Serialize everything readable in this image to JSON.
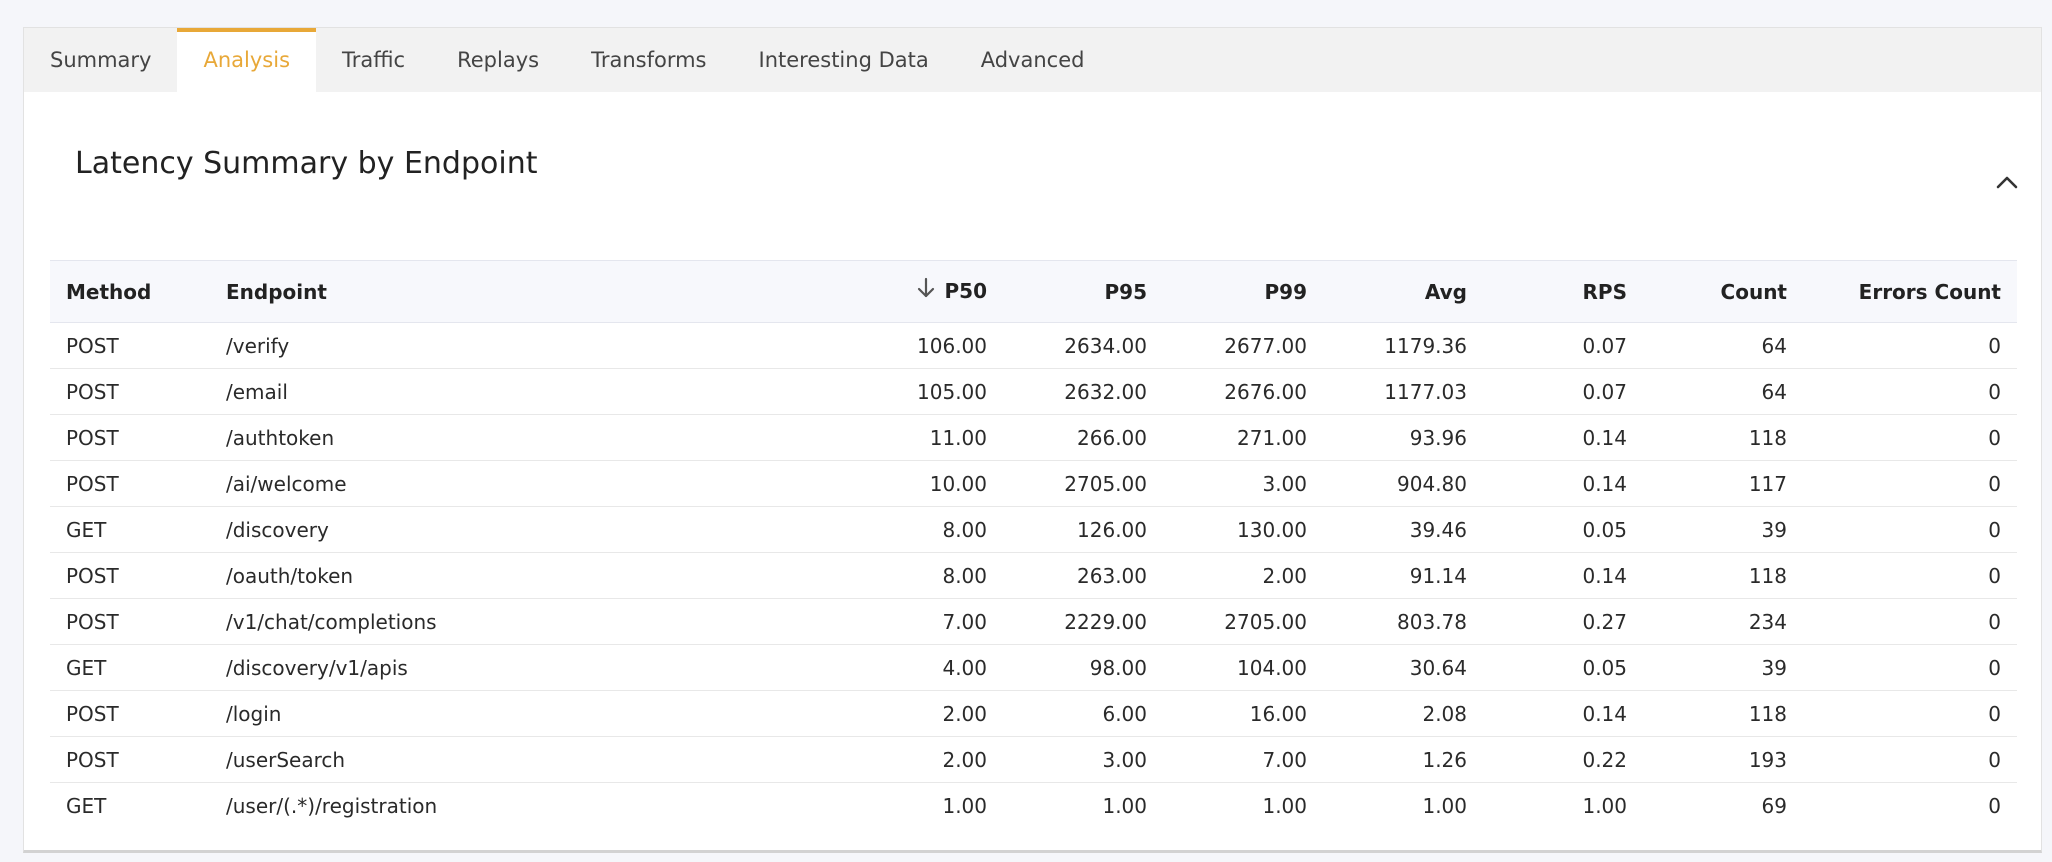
{
  "tabs": [
    {
      "label": "Summary",
      "active": false
    },
    {
      "label": "Analysis",
      "active": true
    },
    {
      "label": "Traffic",
      "active": false
    },
    {
      "label": "Replays",
      "active": false
    },
    {
      "label": "Transforms",
      "active": false
    },
    {
      "label": "Interesting Data",
      "active": false
    },
    {
      "label": "Advanced",
      "active": false
    }
  ],
  "panel": {
    "title": "Latency Summary by Endpoint",
    "collapse_icon": "chevron-up-icon"
  },
  "table": {
    "sort_icon": "arrow-down-icon",
    "sorted_column": "P50",
    "columns": [
      "Method",
      "Endpoint",
      "P50",
      "P95",
      "P99",
      "Avg",
      "RPS",
      "Count",
      "Errors Count"
    ],
    "rows": [
      {
        "method": "POST",
        "endpoint": "/verify",
        "p50": "106.00",
        "p95": "2634.00",
        "p99": "2677.00",
        "avg": "1179.36",
        "rps": "0.07",
        "count": "64",
        "errors": "0"
      },
      {
        "method": "POST",
        "endpoint": "/email",
        "p50": "105.00",
        "p95": "2632.00",
        "p99": "2676.00",
        "avg": "1177.03",
        "rps": "0.07",
        "count": "64",
        "errors": "0"
      },
      {
        "method": "POST",
        "endpoint": "/authtoken",
        "p50": "11.00",
        "p95": "266.00",
        "p99": "271.00",
        "avg": "93.96",
        "rps": "0.14",
        "count": "118",
        "errors": "0"
      },
      {
        "method": "POST",
        "endpoint": "/ai/welcome",
        "p50": "10.00",
        "p95": "2705.00",
        "p99": "3.00",
        "avg": "904.80",
        "rps": "0.14",
        "count": "117",
        "errors": "0"
      },
      {
        "method": "GET",
        "endpoint": "/discovery",
        "p50": "8.00",
        "p95": "126.00",
        "p99": "130.00",
        "avg": "39.46",
        "rps": "0.05",
        "count": "39",
        "errors": "0"
      },
      {
        "method": "POST",
        "endpoint": "/oauth/token",
        "p50": "8.00",
        "p95": "263.00",
        "p99": "2.00",
        "avg": "91.14",
        "rps": "0.14",
        "count": "118",
        "errors": "0"
      },
      {
        "method": "POST",
        "endpoint": "/v1/chat/completions",
        "p50": "7.00",
        "p95": "2229.00",
        "p99": "2705.00",
        "avg": "803.78",
        "rps": "0.27",
        "count": "234",
        "errors": "0"
      },
      {
        "method": "GET",
        "endpoint": "/discovery/v1/apis",
        "p50": "4.00",
        "p95": "98.00",
        "p99": "104.00",
        "avg": "30.64",
        "rps": "0.05",
        "count": "39",
        "errors": "0"
      },
      {
        "method": "POST",
        "endpoint": "/login",
        "p50": "2.00",
        "p95": "6.00",
        "p99": "16.00",
        "avg": "2.08",
        "rps": "0.14",
        "count": "118",
        "errors": "0"
      },
      {
        "method": "POST",
        "endpoint": "/userSearch",
        "p50": "2.00",
        "p95": "3.00",
        "p99": "7.00",
        "avg": "1.26",
        "rps": "0.22",
        "count": "193",
        "errors": "0"
      },
      {
        "method": "GET",
        "endpoint": "/user/(.*)/registration",
        "p50": "1.00",
        "p95": "1.00",
        "p99": "1.00",
        "avg": "1.00",
        "rps": "1.00",
        "count": "69",
        "errors": "0"
      }
    ]
  },
  "colors": {
    "accent": "#e8a838",
    "tabbar_bg": "#f2f2f2",
    "page_bg": "#f5f6fa",
    "header_row_bg": "#f7f8fc"
  }
}
